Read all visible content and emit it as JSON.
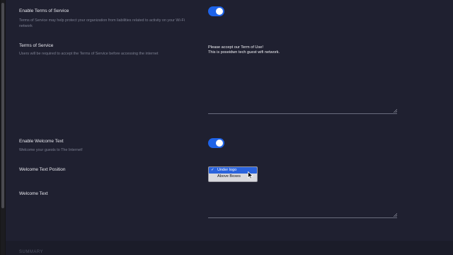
{
  "terms": {
    "enable_label": "Enable Terms of Service",
    "enable_desc": "Terms of Service may help protect your organization from liabilities related to activity on your Wi-Fi network",
    "label": "Terms of Service",
    "desc": "Users will be required to accept the Terms of Service before accessing the internet",
    "text_line1": "Please accept our Term of Use!",
    "text_line2": "This is poseidwn tech guest wifi network."
  },
  "welcome": {
    "enable_label": "Enable Welcome Text",
    "enable_desc": "Welcome your guests to The Internet!",
    "position_label": "Welcome Text Position",
    "position_options": [
      {
        "label": "Under logo",
        "selected": true,
        "check": "✓"
      },
      {
        "label": "Above Boxes",
        "selected": false
      }
    ],
    "text_label": "Welcome Text",
    "text_value": ""
  },
  "footer": {
    "section_title": "SUMMARY"
  },
  "colors": {
    "panel_bg": "#1f2030",
    "toggle_on": "#1e63e8",
    "option_highlight": "#2a63dd"
  }
}
